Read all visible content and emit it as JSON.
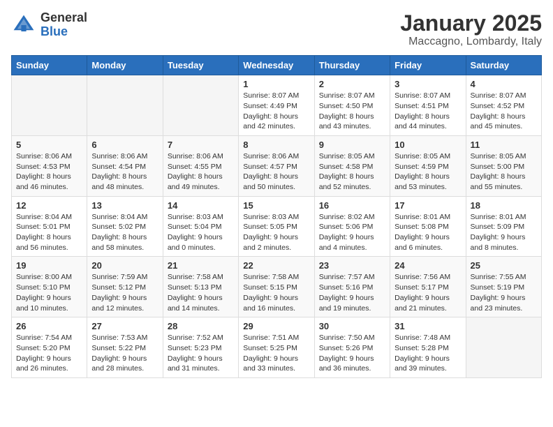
{
  "header": {
    "logo": {
      "general": "General",
      "blue": "Blue"
    },
    "month": "January 2025",
    "location": "Maccagno, Lombardy, Italy"
  },
  "weekdays": [
    "Sunday",
    "Monday",
    "Tuesday",
    "Wednesday",
    "Thursday",
    "Friday",
    "Saturday"
  ],
  "weeks": [
    [
      {
        "day": "",
        "info": ""
      },
      {
        "day": "",
        "info": ""
      },
      {
        "day": "",
        "info": ""
      },
      {
        "day": "1",
        "info": "Sunrise: 8:07 AM\nSunset: 4:49 PM\nDaylight: 8 hours and 42 minutes."
      },
      {
        "day": "2",
        "info": "Sunrise: 8:07 AM\nSunset: 4:50 PM\nDaylight: 8 hours and 43 minutes."
      },
      {
        "day": "3",
        "info": "Sunrise: 8:07 AM\nSunset: 4:51 PM\nDaylight: 8 hours and 44 minutes."
      },
      {
        "day": "4",
        "info": "Sunrise: 8:07 AM\nSunset: 4:52 PM\nDaylight: 8 hours and 45 minutes."
      }
    ],
    [
      {
        "day": "5",
        "info": "Sunrise: 8:06 AM\nSunset: 4:53 PM\nDaylight: 8 hours and 46 minutes."
      },
      {
        "day": "6",
        "info": "Sunrise: 8:06 AM\nSunset: 4:54 PM\nDaylight: 8 hours and 48 minutes."
      },
      {
        "day": "7",
        "info": "Sunrise: 8:06 AM\nSunset: 4:55 PM\nDaylight: 8 hours and 49 minutes."
      },
      {
        "day": "8",
        "info": "Sunrise: 8:06 AM\nSunset: 4:57 PM\nDaylight: 8 hours and 50 minutes."
      },
      {
        "day": "9",
        "info": "Sunrise: 8:05 AM\nSunset: 4:58 PM\nDaylight: 8 hours and 52 minutes."
      },
      {
        "day": "10",
        "info": "Sunrise: 8:05 AM\nSunset: 4:59 PM\nDaylight: 8 hours and 53 minutes."
      },
      {
        "day": "11",
        "info": "Sunrise: 8:05 AM\nSunset: 5:00 PM\nDaylight: 8 hours and 55 minutes."
      }
    ],
    [
      {
        "day": "12",
        "info": "Sunrise: 8:04 AM\nSunset: 5:01 PM\nDaylight: 8 hours and 56 minutes."
      },
      {
        "day": "13",
        "info": "Sunrise: 8:04 AM\nSunset: 5:02 PM\nDaylight: 8 hours and 58 minutes."
      },
      {
        "day": "14",
        "info": "Sunrise: 8:03 AM\nSunset: 5:04 PM\nDaylight: 9 hours and 0 minutes."
      },
      {
        "day": "15",
        "info": "Sunrise: 8:03 AM\nSunset: 5:05 PM\nDaylight: 9 hours and 2 minutes."
      },
      {
        "day": "16",
        "info": "Sunrise: 8:02 AM\nSunset: 5:06 PM\nDaylight: 9 hours and 4 minutes."
      },
      {
        "day": "17",
        "info": "Sunrise: 8:01 AM\nSunset: 5:08 PM\nDaylight: 9 hours and 6 minutes."
      },
      {
        "day": "18",
        "info": "Sunrise: 8:01 AM\nSunset: 5:09 PM\nDaylight: 9 hours and 8 minutes."
      }
    ],
    [
      {
        "day": "19",
        "info": "Sunrise: 8:00 AM\nSunset: 5:10 PM\nDaylight: 9 hours and 10 minutes."
      },
      {
        "day": "20",
        "info": "Sunrise: 7:59 AM\nSunset: 5:12 PM\nDaylight: 9 hours and 12 minutes."
      },
      {
        "day": "21",
        "info": "Sunrise: 7:58 AM\nSunset: 5:13 PM\nDaylight: 9 hours and 14 minutes."
      },
      {
        "day": "22",
        "info": "Sunrise: 7:58 AM\nSunset: 5:15 PM\nDaylight: 9 hours and 16 minutes."
      },
      {
        "day": "23",
        "info": "Sunrise: 7:57 AM\nSunset: 5:16 PM\nDaylight: 9 hours and 19 minutes."
      },
      {
        "day": "24",
        "info": "Sunrise: 7:56 AM\nSunset: 5:17 PM\nDaylight: 9 hours and 21 minutes."
      },
      {
        "day": "25",
        "info": "Sunrise: 7:55 AM\nSunset: 5:19 PM\nDaylight: 9 hours and 23 minutes."
      }
    ],
    [
      {
        "day": "26",
        "info": "Sunrise: 7:54 AM\nSunset: 5:20 PM\nDaylight: 9 hours and 26 minutes."
      },
      {
        "day": "27",
        "info": "Sunrise: 7:53 AM\nSunset: 5:22 PM\nDaylight: 9 hours and 28 minutes."
      },
      {
        "day": "28",
        "info": "Sunrise: 7:52 AM\nSunset: 5:23 PM\nDaylight: 9 hours and 31 minutes."
      },
      {
        "day": "29",
        "info": "Sunrise: 7:51 AM\nSunset: 5:25 PM\nDaylight: 9 hours and 33 minutes."
      },
      {
        "day": "30",
        "info": "Sunrise: 7:50 AM\nSunset: 5:26 PM\nDaylight: 9 hours and 36 minutes."
      },
      {
        "day": "31",
        "info": "Sunrise: 7:48 AM\nSunset: 5:28 PM\nDaylight: 9 hours and 39 minutes."
      },
      {
        "day": "",
        "info": ""
      }
    ]
  ]
}
